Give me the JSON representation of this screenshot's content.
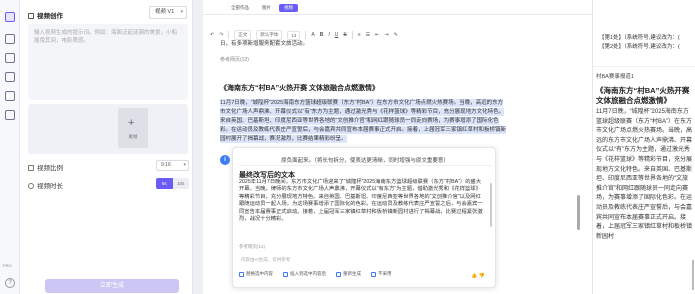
{
  "sidebar_rail": {
    "icons": [
      "edit-icon",
      "image-icon",
      "video-icon",
      "chat-icon",
      "template-icon",
      "history-icon"
    ],
    "pro_label": "PRO",
    "help_label": "?"
  },
  "creation_panel": {
    "title": "视频创作",
    "version": "视频 V1",
    "prompt_placeholder": "输入视频生成的提示词。例如：海面泛起涟漪的美景，小船摇曳其间，电影质感。",
    "upload_label": "尾帧",
    "ratio_label": "视频比例",
    "ratio_value": "9:16",
    "duration_label": "视频时长",
    "duration_on": "5s",
    "duration_off": "10s",
    "generate_label": "立即生成"
  },
  "editor": {
    "tabs": [
      "全部作品",
      "图片",
      "视频"
    ],
    "active_tab_index": 2,
    "toolbar": {
      "format_dropdown": "正文",
      "font_dropdown": "默认字体",
      "size_dropdown": "14",
      "buttons": [
        "↶",
        "↷",
        "A",
        "B",
        "I",
        "U",
        "S",
        "≡",
        "☰",
        "⇤",
        "⇥",
        "✎"
      ]
    },
    "doc_lines": [
      "日，有多项新增服务配套文旅活动。",
      "参考网页(12)"
    ],
    "heading": "《海南东方“村BA”火热开赛 文体旅融合点燃激情》",
    "highlighted_text": "11月7日晚，“城隍杯”2025海南东方篮球超级联赛（东方“村BA”）在东方市文化广场点燃火热赛场。当晚，高远的东方市文化广场人声鼎沸、开幕仪式以“有”东方为主题，通过激光秀与《花样篮球》等精彩节目，充分展现地方文化特色。来自英国、巴基斯坦、印度尼西亚等世界各地的“文创推介官”和网红跟随球员一同走向赛场，为赛事增添了国际化色彩。在运动员及教练代表庄严宣誓后，与会嘉宾共同宣布本届赛事正式开启。接着，上届冠军三家镇红草村和板桥镇新园村展开了揭幕战，赛况激烈，比赛结果精彩纷呈。",
    "highlight_ref": "参考网页(12)"
  },
  "ai_popup": {
    "question": "原负面起来。（将长句拆分，使表达更清晰，同时增强与原文重要意）",
    "answer_title": "最终改写后的文本",
    "answer_body": "2025年11月7日晚间，东方市文化广场迎来了“城隍杯”2025海南东方篮球超级联赛（东方“村BA”）的盛大开幕。当晚，律师的东方市文化广场人声鼎沸，开幕仪式以“有东方”为主题，借助激光秀和《花样篮球》等精彩节目，充分展现地方特色。来自英国、巴基斯坦、印度尼西亚等世界各地的“文创推介官”以及网红跟随运动员一起人场，为这场赛事增添了国际化的色彩。在运动员及教练代表庄严宣誓之后，与会嘉宾一同宣告本届赛事正式启动。接着，上届冠军三家镇红草村和板桥镇新园村进行了揭幕战，比赛过程紧张激烈，战况十分精彩。",
    "ref": "参考网页(12)",
    "ai_note": "内容由AI生成，仅供参考",
    "actions": [
      "替换选中内容",
      "插入到选中内容后",
      "重新生成",
      "不采用"
    ],
    "thumbs": "👍 👎"
  },
  "preview": {
    "records": [
      "【第1处】（系统符号,建议改为：(",
      "【第2处】（系统符号,建议改为：("
    ],
    "note": "村BA赛事报道1",
    "title": "《海南东方“村BA”火热开赛 文体旅融合点燃激情》",
    "body": "11月7日晚，“城隍杯”2025海南东方篮球超级联赛（东方“村BA”）在东方市文化广场点燃火热赛场。当晚，高远的东方市文化广场人声鼎沸、开幕仪式以“有”东方为主题，通过激光秀与《花样篮球》等精彩节目，充分展现地方文化特色。来自英国、巴基斯坦、印度尼西亚等世界各地的“文旅推介官”和网红跟随球员一同走向赛场，为赛事增添了国际化色彩。在运动员及教练代表庄严宣誓后，与会嘉宾共同宣布本届赛事正式开启。接着，上届冠军三家镇红草村和板桥镇新园村"
  }
}
